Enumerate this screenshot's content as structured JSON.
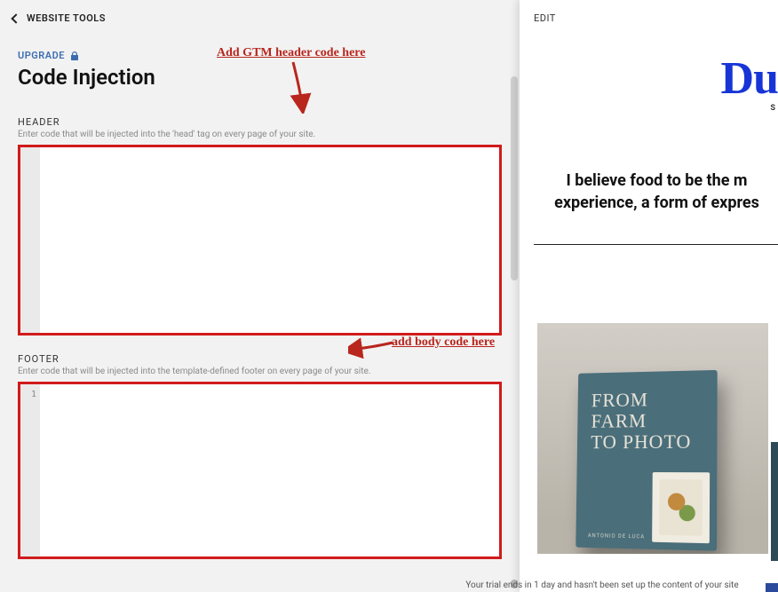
{
  "topbar": {
    "back_label": "WEBSITE TOOLS"
  },
  "upgrade": {
    "label": "UPGRADE"
  },
  "page": {
    "title": "Code Injection"
  },
  "header_section": {
    "label": "HEADER",
    "help": "Enter code that will be injected into the 'head' tag on every page of your site.",
    "gutter": "",
    "value": ""
  },
  "footer_section": {
    "label": "FOOTER",
    "help": "Enter code that will be injected into the template-defined footer on every page of your site.",
    "gutter": "1",
    "value": ""
  },
  "annotations": {
    "header_note": "Add GTM header code here",
    "footer_note": "add body code here"
  },
  "preview": {
    "edit_label": "EDIT",
    "logo_main": "Du",
    "logo_sub": "S",
    "hero_line1": "I believe food to be the m",
    "hero_line2": "experience, a form of expres",
    "book_title_line1": "FROM FARM",
    "book_title_line2": "TO PHOTO",
    "book_author": "ANTONIO DE LUCA"
  },
  "bottom_hint": "Your trial ends in 1 day and hasn't been set up the content of your site"
}
